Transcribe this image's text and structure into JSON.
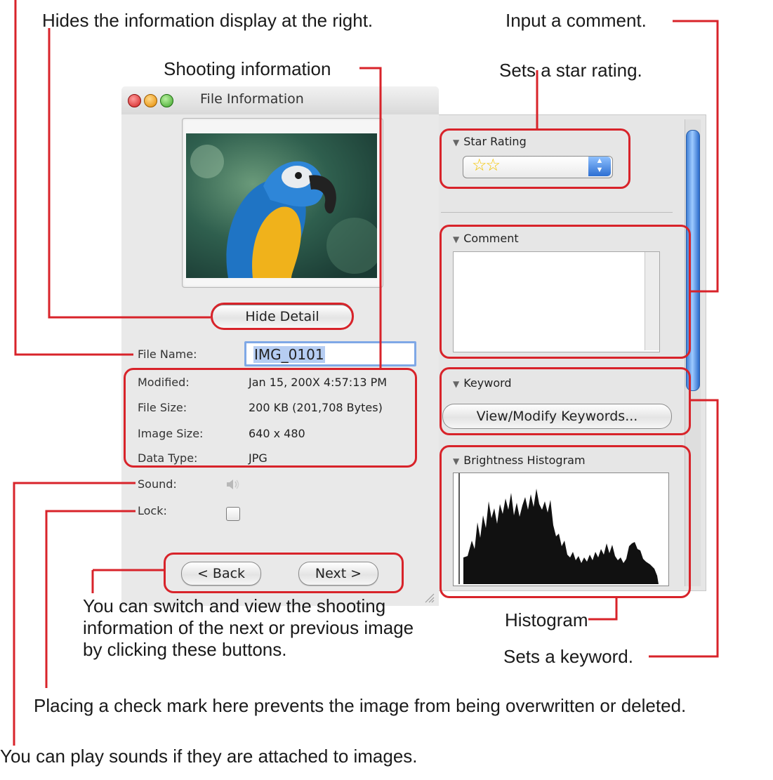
{
  "callouts": {
    "hide_info": "Hides the information display at the right.",
    "shooting_info": "Shooting information",
    "input_comment": "Input a comment.",
    "star_rating": "Sets a star rating.",
    "switch_info": "You can switch and view the shooting information of the next or previous image by clicking these buttons.",
    "histogram": "Histogram",
    "keyword": "Sets a keyword.",
    "lock": "Placing a check mark here prevents the image from being overwritten or deleted.",
    "sound": "You can play sounds if they are attached to images."
  },
  "window": {
    "title": "File Information",
    "hide_detail_label": "Hide Detail",
    "file_name_label": "File Name:",
    "file_name_value": "IMG_0101",
    "fields": [
      {
        "label": "Modified:",
        "value": "Jan 15, 200X 4:57:13 PM"
      },
      {
        "label": "File Size:",
        "value": "200 KB (201,708 Bytes)"
      },
      {
        "label": "Image Size:",
        "value": "640 x 480"
      },
      {
        "label": "Data Type:",
        "value": "JPG"
      }
    ],
    "sound_label": "Sound:",
    "lock_label": "Lock:",
    "back_label": "< Back",
    "next_label": "Next >"
  },
  "drawer": {
    "star_rating_title": "Star Rating",
    "star_rating_value": "☆☆",
    "comment_title": "Comment",
    "keyword_title": "Keyword",
    "keyword_button": "View/Modify Keywords...",
    "histogram_title": "Brightness Histogram"
  },
  "colors": {
    "highlight": "#d8232a",
    "accent": "#3f7fd6"
  },
  "icons": [
    "close-light-icon",
    "minimize-light-icon",
    "zoom-light-icon",
    "speaker-icon",
    "disclosure-triangle-icon",
    "popup-arrows-icon",
    "resize-grip-icon"
  ]
}
